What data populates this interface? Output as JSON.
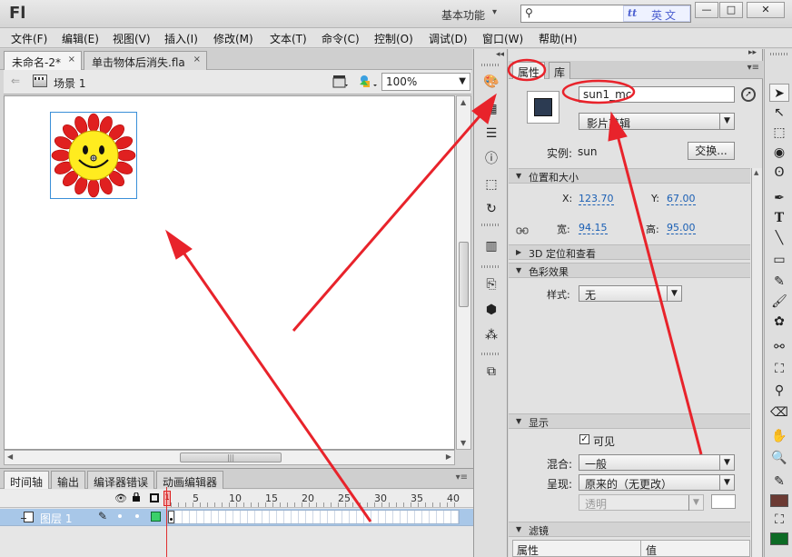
{
  "app": {
    "logo": "Fl",
    "workspace_label": "基本功能",
    "search_badge": {
      "icon": "tt",
      "text": "英文"
    },
    "window_controls": {
      "minimize": "—",
      "maximize": "□",
      "close": "✕"
    }
  },
  "menu": [
    "文件(F)",
    "编辑(E)",
    "视图(V)",
    "插入(I)",
    "修改(M)",
    "文本(T)",
    "命令(C)",
    "控制(O)",
    "调试(D)",
    "窗口(W)",
    "帮助(H)"
  ],
  "document_tabs": [
    {
      "label": "未命名-2*",
      "close": "×"
    },
    {
      "label": "单击物体后消失.fla",
      "close": "×"
    }
  ],
  "scene_bar": {
    "back": "⇐",
    "scene_label": "场景 1",
    "zoom": "100%"
  },
  "stage": {
    "background": "#ffffff",
    "symbol_name": "sun"
  },
  "timeline": {
    "tabs": [
      "时间轴",
      "输出",
      "编译器错误",
      "动画编辑器"
    ],
    "frame_numbers": [
      "1",
      "5",
      "10",
      "15",
      "20",
      "25",
      "30",
      "35",
      "40"
    ],
    "layer_name": "图层 1",
    "current_frame": "1"
  },
  "properties": {
    "tabs": [
      "属性",
      "库"
    ],
    "instance_name": "sun1_mc",
    "symbol_type": "影片剪辑",
    "instance_label": "实例:",
    "instance_value": "sun",
    "swap_button": "交换...",
    "sections": {
      "position": "位置和大小",
      "3d": "3D 定位和查看",
      "color": "色彩效果",
      "display": "显示",
      "filters": "滤镜"
    },
    "position": {
      "x_label": "X:",
      "x_value": "123.70",
      "y_label": "Y:",
      "y_value": "67.00",
      "w_label": "宽:",
      "w_value": "94.15",
      "h_label": "高:",
      "h_value": "95.00"
    },
    "color_effect": {
      "style_label": "样式:",
      "style_value": "无"
    },
    "display": {
      "visible_label": "可见",
      "visible_checked": true,
      "blend_label": "混合:",
      "blend_value": "一般",
      "render_label": "呈现:",
      "render_value": "原来的（无更改）",
      "transparency_value": "透明"
    },
    "filters_grid": {
      "col_property": "属性",
      "col_value": "值"
    }
  },
  "colors": {
    "annotation_red": "#e8232b",
    "sun_petal": "#e02020",
    "sun_face": "#ffec1f",
    "stroke_color": "#6b3a33",
    "fill_color": "#0d6b25",
    "layer_highlight": "#a8c7e8"
  }
}
